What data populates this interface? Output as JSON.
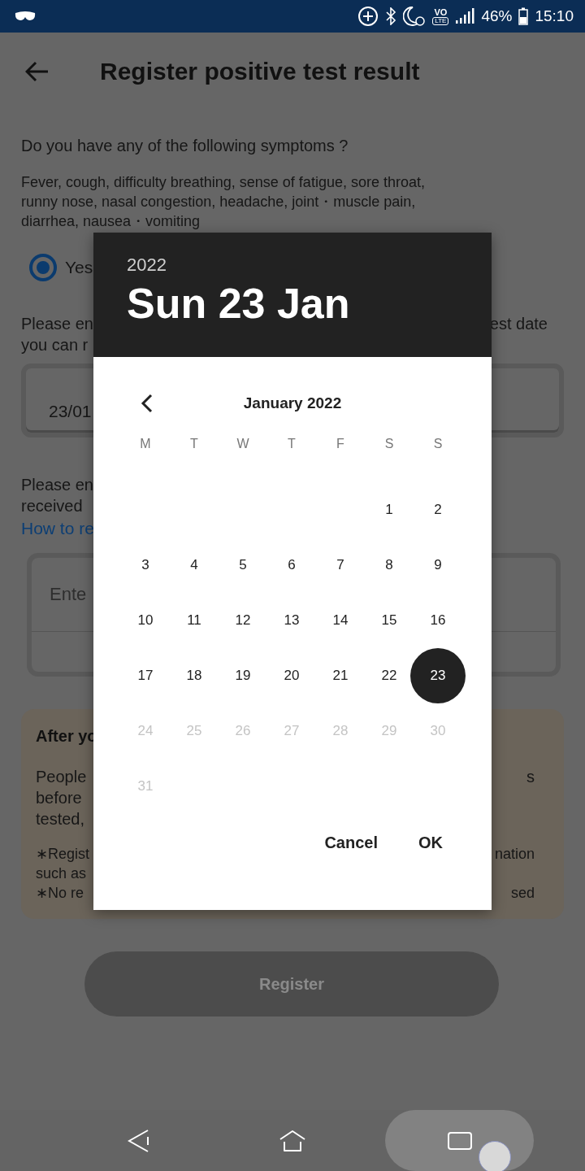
{
  "status_bar": {
    "network_badge": [
      "VO",
      "LTE"
    ],
    "battery": "46%",
    "time": "15:10"
  },
  "header": {
    "title": "Register positive test result"
  },
  "question": "Do you have any of the following symptoms ?",
  "symptoms": [
    "Fever, cough, difficulty breathing, sense of fatigue, sore throat,",
    "runny nose, nasal congestion, headache, joint・muscle pain,",
    "diarrhea, nausea・vomiting"
  ],
  "symptom_answer": {
    "label": "Yes",
    "selected": true
  },
  "test_date": {
    "prompt": [
      {
        "left": "Please en",
        "right": "est date"
      },
      {
        "left": "you can r"
      }
    ],
    "value": "23/01"
  },
  "code": {
    "prompt": [
      {
        "left": "Please en"
      },
      {
        "left": "received"
      }
    ],
    "link": "How to re",
    "placeholder": "Ente"
  },
  "notice": {
    "title": "After yo",
    "body": [
      {
        "left": "People",
        "right": "s"
      },
      {
        "left": "before"
      },
      {
        "left": "tested,"
      }
    ],
    "notes": [
      {
        "left": "∗Regist",
        "right": "nation"
      },
      {
        "left": "such as"
      },
      {
        "left": "∗No re",
        "right": "sed"
      }
    ]
  },
  "register_button": {
    "label": "Register",
    "disabled": true
  },
  "date_picker": {
    "year": "2022",
    "date": "Sun 23 Jan",
    "month": "January 2022",
    "weekdays": [
      "M",
      "T",
      "W",
      "T",
      "F",
      "S",
      "S"
    ],
    "weeks": [
      [
        {
          "label": "1",
          "selected": false,
          "disabled": false
        },
        {
          "label": "2",
          "selected": false,
          "disabled": false
        }
      ],
      [
        {
          "label": "3",
          "selected": false,
          "disabled": false
        },
        {
          "label": "4",
          "selected": false,
          "disabled": false
        },
        {
          "label": "5",
          "selected": false,
          "disabled": false
        },
        {
          "label": "6",
          "selected": false,
          "disabled": false
        },
        {
          "label": "7",
          "selected": false,
          "disabled": false
        },
        {
          "label": "8",
          "selected": false,
          "disabled": false
        },
        {
          "label": "9",
          "selected": false,
          "disabled": false
        }
      ],
      [
        {
          "label": "10",
          "selected": false,
          "disabled": false
        },
        {
          "label": "11",
          "selected": false,
          "disabled": false
        },
        {
          "label": "12",
          "selected": false,
          "disabled": false
        },
        {
          "label": "13",
          "selected": false,
          "disabled": false
        },
        {
          "label": "14",
          "selected": false,
          "disabled": false
        },
        {
          "label": "15",
          "selected": false,
          "disabled": false
        },
        {
          "label": "16",
          "selected": false,
          "disabled": false
        }
      ],
      [
        {
          "label": "17",
          "selected": false,
          "disabled": false
        },
        {
          "label": "18",
          "selected": false,
          "disabled": false
        },
        {
          "label": "19",
          "selected": false,
          "disabled": false
        },
        {
          "label": "20",
          "selected": false,
          "disabled": false
        },
        {
          "label": "21",
          "selected": false,
          "disabled": false
        },
        {
          "label": "22",
          "selected": false,
          "disabled": false
        },
        {
          "label": "23",
          "selected": true,
          "disabled": false
        }
      ],
      [
        {
          "label": "24",
          "selected": false,
          "disabled": true
        },
        {
          "label": "25",
          "selected": false,
          "disabled": true
        },
        {
          "label": "26",
          "selected": false,
          "disabled": true
        },
        {
          "label": "27",
          "selected": false,
          "disabled": true
        },
        {
          "label": "28",
          "selected": false,
          "disabled": true
        },
        {
          "label": "29",
          "selected": false,
          "disabled": true
        },
        {
          "label": "30",
          "selected": false,
          "disabled": true
        }
      ],
      [
        {
          "label": "31",
          "selected": false,
          "disabled": true
        }
      ]
    ],
    "buttons": [
      "Cancel",
      "OK"
    ]
  }
}
